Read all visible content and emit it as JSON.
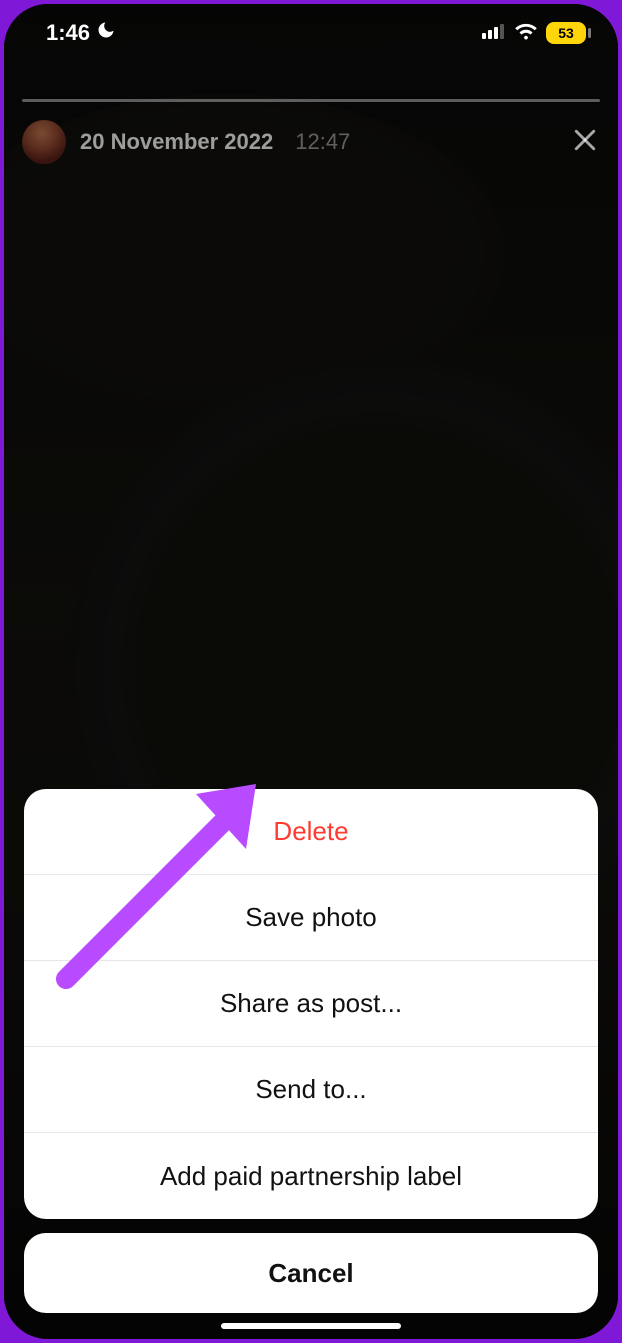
{
  "status": {
    "time": "1:46",
    "battery": "53"
  },
  "story": {
    "date": "20 November 2022",
    "time": "12:47"
  },
  "sheet": {
    "items": [
      {
        "label": "Delete",
        "destructive": true
      },
      {
        "label": "Save photo",
        "destructive": false
      },
      {
        "label": "Share as post...",
        "destructive": false
      },
      {
        "label": "Send to...",
        "destructive": false
      },
      {
        "label": "Add paid partnership label",
        "destructive": false
      }
    ],
    "cancel": "Cancel"
  }
}
